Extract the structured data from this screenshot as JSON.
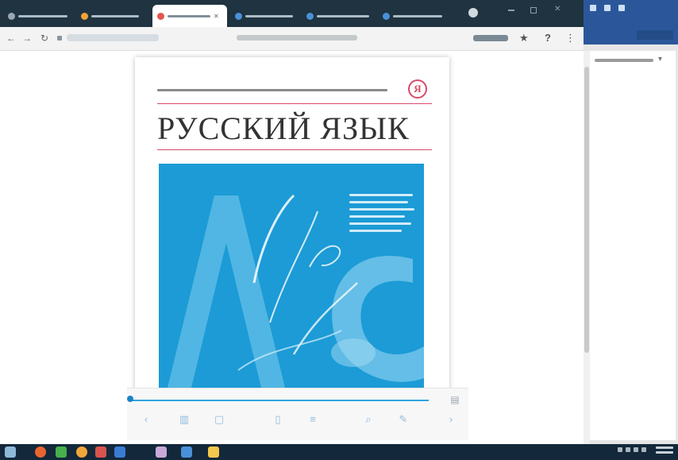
{
  "book": {
    "title": "РУССКИЙ ЯЗЫК",
    "publisher_logo": "Я"
  },
  "browser": {
    "tabs": [
      {
        "favicon_color": "#9aa7b0"
      },
      {
        "favicon_color": "#f2a23a"
      },
      {
        "favicon_color": "#e2574c",
        "active": true
      },
      {
        "favicon_color": "#4a90d9"
      },
      {
        "favicon_color": "#4a90d9"
      },
      {
        "favicon_color": "#4a90d9"
      }
    ],
    "nav_icons": {
      "back": "←",
      "forward": "→",
      "reload": "↻"
    },
    "toolbar_icons": {
      "star": "★",
      "profile": "?",
      "menu": "⋮"
    }
  },
  "reader_toolbar": {
    "progress": 0.0,
    "corner_icon": "▤",
    "buttons": [
      {
        "icon": "‹"
      },
      {
        "icon": "▥"
      },
      {
        "icon": "▢"
      },
      {
        "icon": "▯"
      },
      {
        "icon": "≡"
      },
      {
        "icon": "⌕"
      },
      {
        "icon": "✎"
      },
      {
        "icon": "›"
      }
    ]
  },
  "taskbar": {
    "apps": [
      {
        "color": "#8fb8d8"
      },
      {
        "color": "#e8652f"
      },
      {
        "color": "#47b04b"
      },
      {
        "color": "#f0a73a"
      },
      {
        "color": "#d9534f"
      },
      {
        "color": "#3a7bd5"
      },
      {
        "color": "#c8a9d9"
      },
      {
        "color": "#4a90d9"
      },
      {
        "color": "#f2c94c"
      }
    ]
  },
  "colors": {
    "cover_art": "#1c9bd6",
    "accent_rule": "#d94b6a",
    "word_ribbon": "#2b579a"
  }
}
